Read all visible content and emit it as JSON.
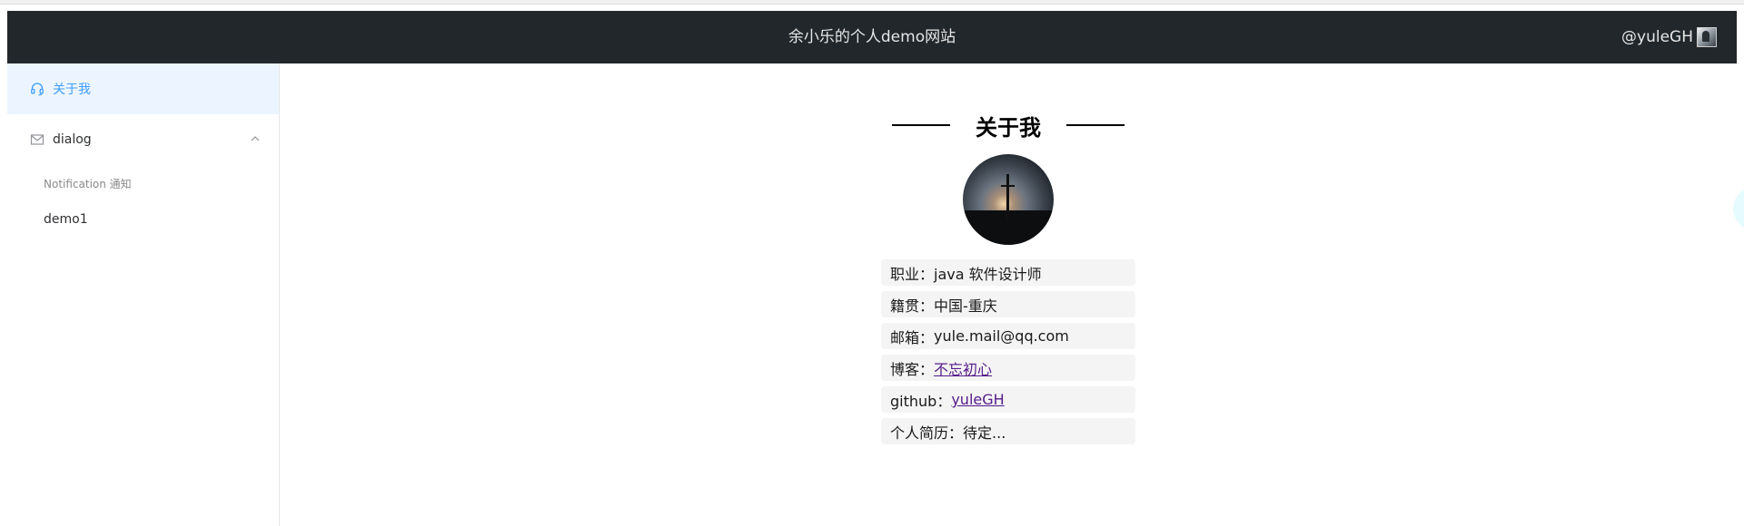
{
  "header": {
    "title": "余小乐的个人demo网站",
    "user": "@yuleGH"
  },
  "sidebar": {
    "items": [
      {
        "label": "关于我",
        "icon": "headset-icon",
        "active": true
      },
      {
        "label": "dialog",
        "icon": "mail-icon",
        "expanded": true,
        "children": [
          {
            "label": "Notification 通知"
          },
          {
            "label": "demo1"
          }
        ]
      }
    ]
  },
  "about": {
    "title": "关于我",
    "rows": [
      {
        "label": "职业：",
        "value": "java 软件设计师"
      },
      {
        "label": "籍贯：",
        "value": "中国-重庆"
      },
      {
        "label": "邮箱：",
        "value": "yule.mail@qq.com"
      },
      {
        "label": "博客：",
        "link": "不忘初心"
      },
      {
        "label": "github：",
        "link": "yuleGH"
      },
      {
        "label": "个人简历：",
        "value": "待定..."
      }
    ]
  },
  "colors": {
    "header_bg": "#22272b",
    "active_bg": "#ecf5ff",
    "active_text": "#409eff",
    "link": "#551a8b"
  }
}
